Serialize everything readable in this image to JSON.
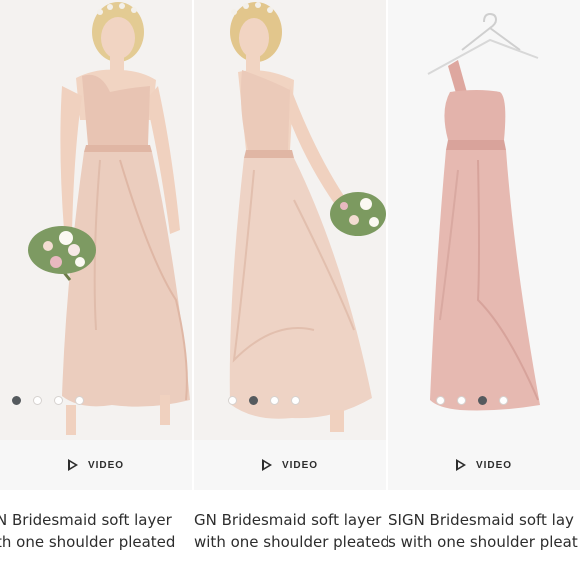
{
  "products": [
    {
      "video_label": "VIDEO",
      "title_line1": "N Bridesmaid soft layer",
      "title_line2": "th one shoulder pleated",
      "image_dots": 4,
      "active_dot": 0
    },
    {
      "video_label": "VIDEO",
      "title_line1": "GN Bridesmaid soft layer",
      "title_line2": "with one shoulder pleated",
      "image_dots": 4,
      "active_dot": 1
    },
    {
      "video_label": "VIDEO",
      "title_line1": "SIGN Bridesmaid soft lay",
      "title_line2": "s with one shoulder pleat",
      "image_dots": 4,
      "active_dot": 2
    }
  ],
  "colors": {
    "photo_background": "#f7f7f7",
    "dress_blush": "#e6c3b4",
    "dress_pink": "#e3b2ab",
    "text": "#2d2d2d",
    "active_dot": "#555a5e"
  }
}
